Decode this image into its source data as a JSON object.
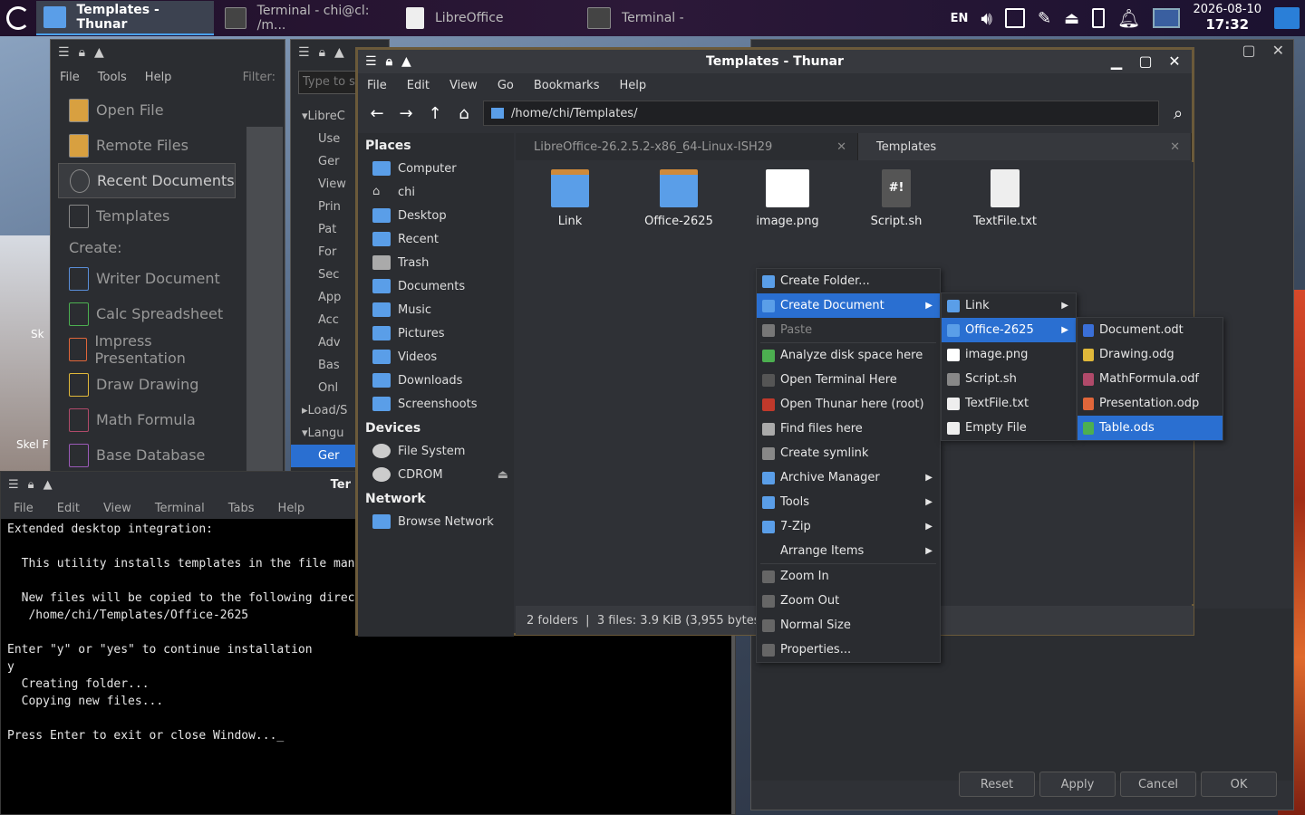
{
  "panel": {
    "tasks": [
      {
        "label": "Templates - Thunar",
        "active": true
      },
      {
        "label": "Terminal - chi@cl: /m..."
      },
      {
        "label": "LibreOffice"
      },
      {
        "label": "Terminal -"
      }
    ],
    "lang": "EN",
    "date": "2026-08-10",
    "time": "17:32"
  },
  "desktop_icons": [
    "Sk",
    "Skel F"
  ],
  "lo": {
    "menu": [
      "File",
      "Tools",
      "Help"
    ],
    "filter": "Filter:",
    "items": [
      "Open File",
      "Remote Files",
      "Recent Documents",
      "Templates"
    ],
    "create": "Create:",
    "create_items": [
      "Writer Document",
      "Calc Spreadsheet",
      "Impress Presentation",
      "Draw Drawing",
      "Math Formula",
      "Base Database"
    ]
  },
  "opt": {
    "search_placeholder": "Type to s",
    "rows": [
      "LibreC",
      "Use",
      "Ger",
      "View",
      "Prin",
      "Pat",
      "For",
      "Sec",
      "App",
      "Acc",
      "Adv",
      "Bas",
      "Onl",
      "Load/S",
      "Langu",
      "Ger"
    ]
  },
  "term": {
    "title": "Ter",
    "menu": [
      "File",
      "Edit",
      "View",
      "Terminal",
      "Tabs",
      "Help"
    ],
    "lines": [
      "Extended desktop integration:",
      "",
      "  This utility installs templates in the file man",
      "",
      "  New files will be copied to the following direc",
      "   /home/chi/Templates/Office-2625",
      "",
      "Enter \"y\" or \"yes\" to continue installation",
      "y",
      "  Creating folder...",
      "  Copying new files...",
      "",
      "Press Enter to exit or close Window..._"
    ]
  },
  "dialog": {
    "buttons": [
      "Reset",
      "Apply",
      "Cancel",
      "OK"
    ]
  },
  "thunar": {
    "title": "Templates - Thunar",
    "menu": [
      "File",
      "Edit",
      "View",
      "Go",
      "Bookmarks",
      "Help"
    ],
    "path": "/home/chi/Templates/",
    "places_header": "Places",
    "places": [
      "Computer",
      "chi",
      "Desktop",
      "Recent",
      "Trash",
      "Documents",
      "Music",
      "Pictures",
      "Videos",
      "Downloads",
      "Screenshoots"
    ],
    "devices_header": "Devices",
    "devices": [
      "File System",
      "CDROM"
    ],
    "network_header": "Network",
    "network": [
      "Browse Network"
    ],
    "tabs": [
      "LibreOffice-26.2.5.2-x86_64-Linux-ISH29",
      "Templates"
    ],
    "files": [
      "Link",
      "Office-2625",
      "image.png",
      "Script.sh",
      "TextFile.txt"
    ],
    "status": "2 folders  |  3 files: 3.9 KiB (3,955 bytes)"
  },
  "ctx": {
    "items": [
      "Create Folder...",
      "Create Document",
      "Paste",
      "Analyze disk space here",
      "Open Terminal Here",
      "Open Thunar here (root)",
      "Find files here",
      "Create symlink",
      "Archive Manager",
      "Tools",
      "7-Zip",
      "Arrange Items",
      "Zoom In",
      "Zoom Out",
      "Normal Size",
      "Properties..."
    ]
  },
  "sub1": {
    "items": [
      "Link",
      "Office-2625",
      "image.png",
      "Script.sh",
      "TextFile.txt",
      "Empty File"
    ]
  },
  "sub2": {
    "items": [
      "Document.odt",
      "Drawing.odg",
      "MathFormula.odf",
      "Presentation.odp",
      "Table.ods"
    ]
  },
  "colors": {
    "accent": "#2a6fd1",
    "folder": "#5a9ee8"
  }
}
